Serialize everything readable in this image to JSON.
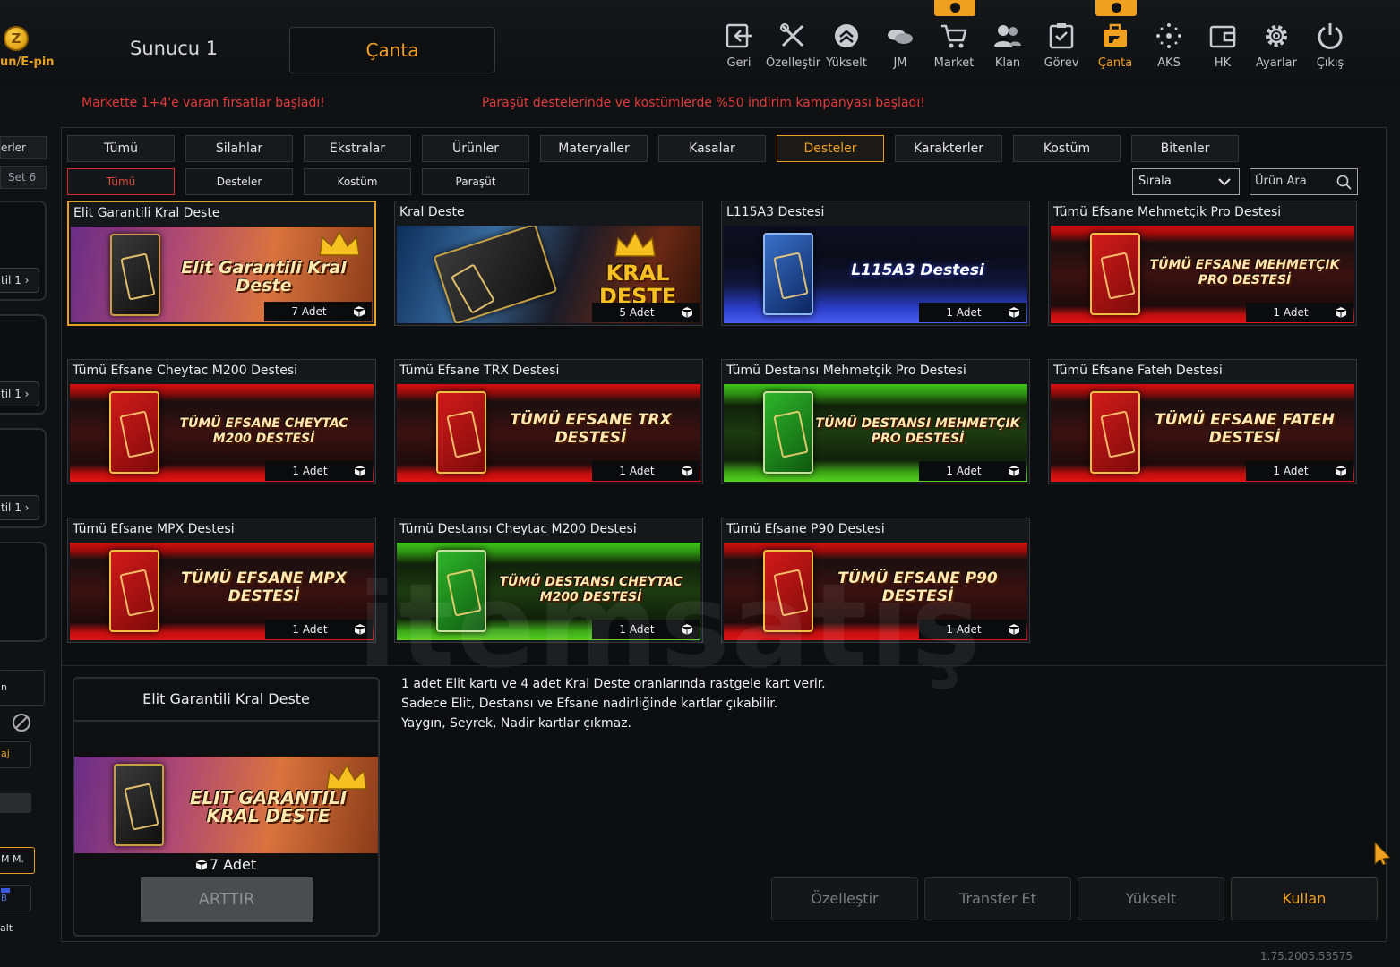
{
  "header": {
    "coin_label": "un/E-pin",
    "server": "Sunucu 1",
    "page_title": "Çanta"
  },
  "nav": [
    {
      "label": "Geri",
      "icon": "back-icon"
    },
    {
      "label": "Özelleştir",
      "icon": "tools-icon"
    },
    {
      "label": "Yükselt",
      "icon": "upgrade-icon"
    },
    {
      "label": "JM",
      "icon": "coins-icon"
    },
    {
      "label": "Market",
      "icon": "cart-icon"
    },
    {
      "label": "Klan",
      "icon": "clan-icon"
    },
    {
      "label": "Görev",
      "icon": "task-icon"
    },
    {
      "label": "Çanta",
      "icon": "bag-icon"
    },
    {
      "label": "AKS",
      "icon": "aks-icon"
    },
    {
      "label": "HK",
      "icon": "wallet-icon"
    },
    {
      "label": "Ayarlar",
      "icon": "gear-icon"
    },
    {
      "label": "Çıkış",
      "icon": "power-icon"
    }
  ],
  "promos": {
    "left": "Markette 1+4'e varan fırsatlar başladı!",
    "right": "Paraşüt destelerinde ve kostümlerde %50 indirim kampanyası başladı!"
  },
  "left_panel": {
    "tab_1": "erler",
    "tab_2": "Set 6",
    "btn_1": "til 1",
    "btn_2": "til 1",
    "btn_3": "til 1",
    "misc_1": "n",
    "misc_2": "aj",
    "misc_3": "M M.",
    "misc_4": "B",
    "misc_5": "alt"
  },
  "tabs": [
    "Tümü",
    "Silahlar",
    "Ekstralar",
    "Ürünler",
    "Materyaller",
    "Kasalar",
    "Desteler",
    "Karakterler",
    "Kostüm",
    "Bitenler"
  ],
  "active_tab": "Desteler",
  "subtabs": [
    "Tümü",
    "Desteler",
    "Kostüm",
    "Paraşüt"
  ],
  "active_subtab": "Tümü",
  "sort": {
    "label": "Sırala"
  },
  "search": {
    "placeholder": "Ürün Ara"
  },
  "items": [
    {
      "name": "Elit Garantili Kral Deste",
      "art": "Elit Garantili Kral Deste",
      "qty": "7 Adet",
      "style": "purple"
    },
    {
      "name": "Kral Deste",
      "art": "KRAL DESTE",
      "qty": "5 Adet",
      "style": "gold"
    },
    {
      "name": "L115A3 Destesi",
      "art": "L115A3 Destesi",
      "qty": "1 Adet",
      "style": "blue"
    },
    {
      "name": "Tümü Efsane Mehmetçik Pro Destesi",
      "art": "TÜMÜ EFSANE MEHMETÇIK PRO DESTESİ",
      "qty": "1 Adet",
      "style": "red"
    },
    {
      "name": "Tümü Efsane Cheytac M200 Destesi",
      "art": "TÜMÜ EFSANE CHEYTAC M200 DESTESİ",
      "qty": "1 Adet",
      "style": "red"
    },
    {
      "name": "Tümü Efsane TRX Destesi",
      "art": "TÜMÜ EFSANE TRX DESTESİ",
      "qty": "1 Adet",
      "style": "red"
    },
    {
      "name": "Tümü Destansı Mehmetçik Pro Destesi",
      "art": "TÜMÜ DESTANSI MEHMETÇIK PRO DESTESİ",
      "qty": "1 Adet",
      "style": "green"
    },
    {
      "name": "Tümü Efsane Fateh Destesi",
      "art": "TÜMÜ EFSANE FATEH DESTESİ",
      "qty": "1 Adet",
      "style": "red"
    },
    {
      "name": "Tümü Efsane MPX Destesi",
      "art": "TÜMÜ EFSANE MPX DESTESİ",
      "qty": "1 Adet",
      "style": "red"
    },
    {
      "name": "Tümü Destansı Cheytac M200 Destesi",
      "art": "TÜMÜ DESTANSI CHEYTAC M200 DESTESİ",
      "qty": "1 Adet",
      "style": "green"
    },
    {
      "name": "Tümü Efsane P90 Destesi",
      "art": "TÜMÜ EFSANE P90 DESTESİ",
      "qty": "1 Adet",
      "style": "red"
    }
  ],
  "watermark": "itemsatış",
  "detail": {
    "name": "Elit Garantili Kral Deste",
    "art": "Elit Garantili Kral Deste",
    "qty": "7 Adet",
    "increase_label": "ARTTIR",
    "description": [
      "1 adet Elit kartı ve 4 adet Kral Deste oranlarında rastgele kart verir.",
      "Sadece Elit, Destansı ve Efsane nadirliğinde kartlar çıkabilir.",
      "Yaygın, Seyrek, Nadir kartlar çıkmaz."
    ]
  },
  "actions": {
    "customize": "Özelleştir",
    "transfer": "Transfer Et",
    "upgrade": "Yükselt",
    "use": "Kullan"
  },
  "version": "1.75.2005.53575",
  "colors": {
    "accent": "#f0a020",
    "promo": "#e23b3b",
    "selected_subtab": "#d12d2d"
  }
}
